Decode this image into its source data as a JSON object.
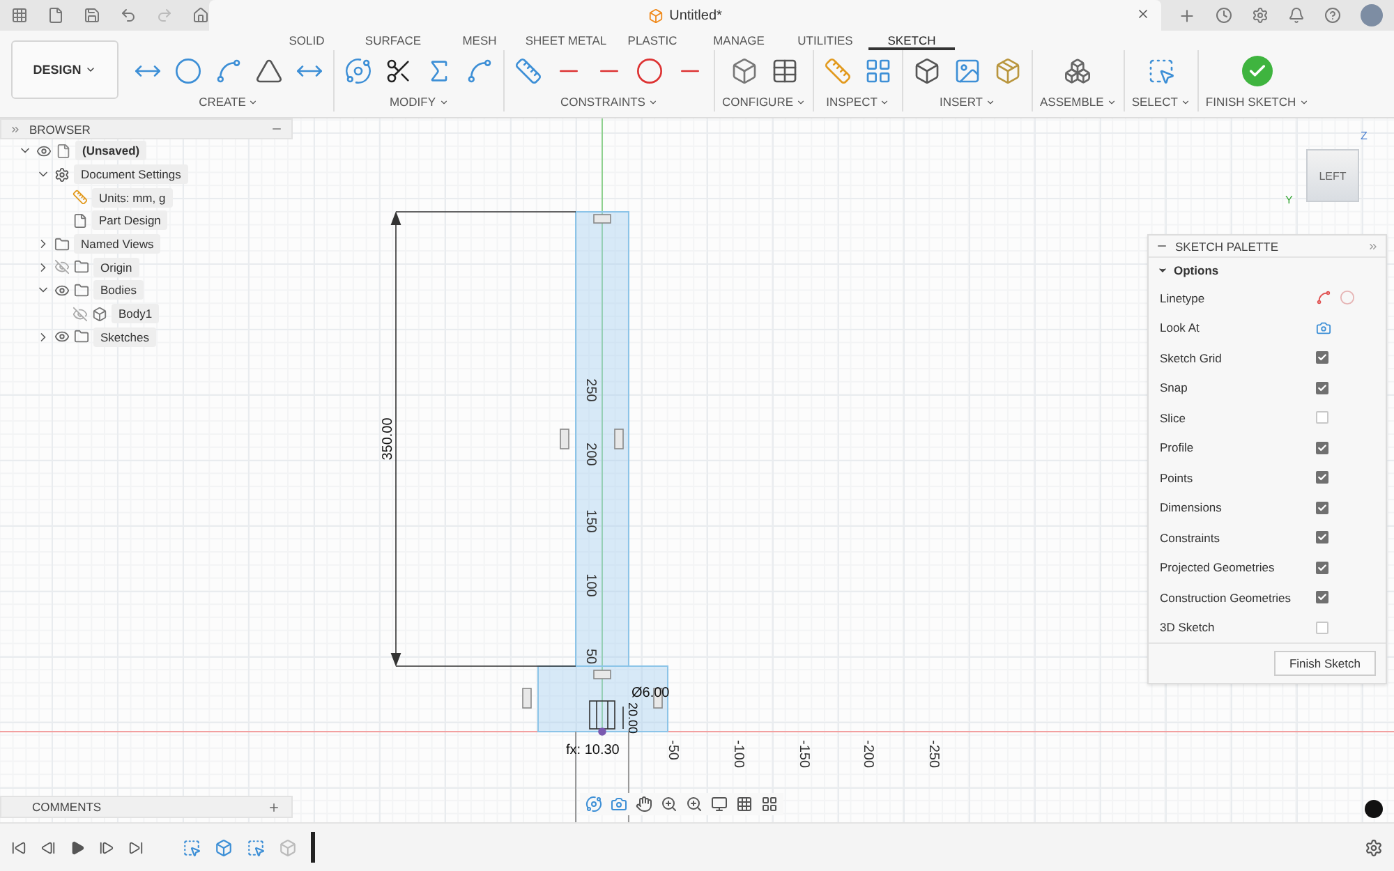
{
  "title_bar": {
    "document_title": "Untitled*"
  },
  "workspace_button": "DESIGN",
  "tabs": [
    {
      "label": "SOLID",
      "selected": false
    },
    {
      "label": "SURFACE",
      "selected": false
    },
    {
      "label": "MESH",
      "selected": false
    },
    {
      "label": "SHEET METAL",
      "selected": false
    },
    {
      "label": "PLASTIC",
      "selected": false
    },
    {
      "label": "MANAGE",
      "selected": false
    },
    {
      "label": "UTILITIES",
      "selected": false
    },
    {
      "label": "SKETCH",
      "selected": true
    }
  ],
  "tool_groups": [
    "CREATE",
    "MODIFY",
    "CONSTRAINTS",
    "CONFIGURE",
    "INSPECT",
    "INSERT",
    "ASSEMBLE",
    "SELECT",
    "FINISH SKETCH"
  ],
  "browser": {
    "title": "BROWSER",
    "tree": [
      {
        "label": "(Unsaved)",
        "kind": "document",
        "expanded": true,
        "visible": true,
        "children": [
          {
            "label": "Document Settings",
            "kind": "settings",
            "expanded": true,
            "children": [
              {
                "label": "Units: mm, g",
                "kind": "units"
              },
              {
                "label": "Part Design",
                "kind": "part"
              }
            ]
          },
          {
            "label": "Named Views",
            "kind": "folder",
            "expanded": false
          },
          {
            "label": "Origin",
            "kind": "folder",
            "expanded": false,
            "visible": false
          },
          {
            "label": "Bodies",
            "kind": "folder",
            "expanded": true,
            "visible": true,
            "children": [
              {
                "label": "Body1",
                "kind": "body",
                "visible": false
              }
            ]
          },
          {
            "label": "Sketches",
            "kind": "folder",
            "expanded": false,
            "visible": true
          }
        ]
      }
    ]
  },
  "comments": {
    "title": "COMMENTS"
  },
  "canvas": {
    "view_cube": {
      "face": "LEFT",
      "up_axis": "Z",
      "side_axis": "Y"
    },
    "height_dimension": "350.00",
    "vertical_axis_labels": [
      "250",
      "200",
      "150",
      "100",
      "50"
    ],
    "horizontal_axis_labels": [
      "-50",
      "-100",
      "-150",
      "-200",
      "-250"
    ],
    "detail_dimensions": [
      "Ø6.00",
      "20.00",
      "fx: 10.30"
    ]
  },
  "sketch_palette": {
    "title": "SKETCH PALETTE",
    "section": {
      "label": "Options",
      "expanded": true
    },
    "options": [
      {
        "label": "Linetype",
        "kind": "linetype"
      },
      {
        "label": "Look At",
        "kind": "action"
      },
      {
        "label": "Sketch Grid",
        "kind": "checkbox",
        "checked": true
      },
      {
        "label": "Snap",
        "kind": "checkbox",
        "checked": true
      },
      {
        "label": "Slice",
        "kind": "checkbox",
        "checked": false
      },
      {
        "label": "Profile",
        "kind": "checkbox",
        "checked": true
      },
      {
        "label": "Points",
        "kind": "checkbox",
        "checked": true
      },
      {
        "label": "Dimensions",
        "kind": "checkbox",
        "checked": true
      },
      {
        "label": "Constraints",
        "kind": "checkbox",
        "checked": true
      },
      {
        "label": "Projected Geometries",
        "kind": "checkbox",
        "checked": true
      },
      {
        "label": "Construction Geometries",
        "kind": "checkbox",
        "checked": true
      },
      {
        "label": "3D Sketch",
        "kind": "checkbox",
        "checked": false
      }
    ],
    "finish_button": "Finish Sketch"
  }
}
